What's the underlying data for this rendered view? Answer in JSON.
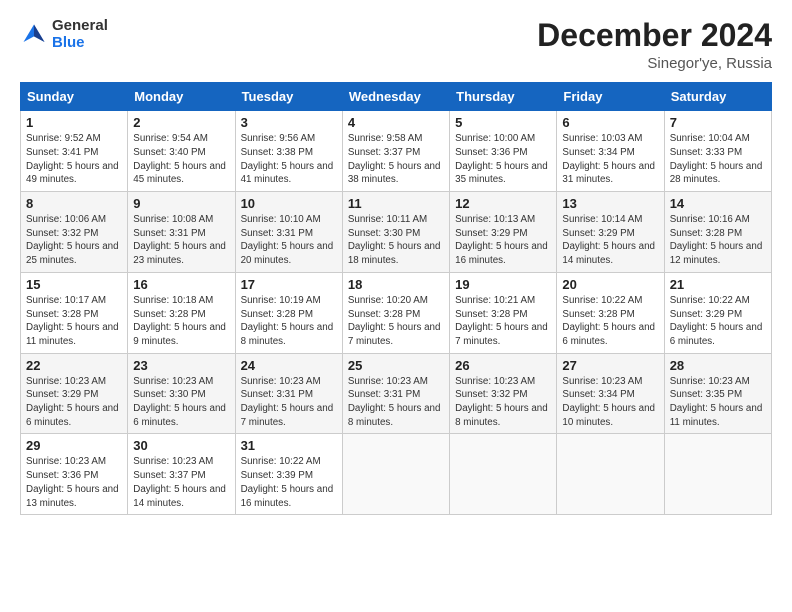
{
  "logo": {
    "text_general": "General",
    "text_blue": "Blue"
  },
  "header": {
    "month": "December 2024",
    "location": "Sinegor'ye, Russia"
  },
  "weekdays": [
    "Sunday",
    "Monday",
    "Tuesday",
    "Wednesday",
    "Thursday",
    "Friday",
    "Saturday"
  ],
  "weeks": [
    [
      {
        "day": "1",
        "sunrise": "9:52 AM",
        "sunset": "3:41 PM",
        "daylight": "5 hours and 49 minutes."
      },
      {
        "day": "2",
        "sunrise": "9:54 AM",
        "sunset": "3:40 PM",
        "daylight": "5 hours and 45 minutes."
      },
      {
        "day": "3",
        "sunrise": "9:56 AM",
        "sunset": "3:38 PM",
        "daylight": "5 hours and 41 minutes."
      },
      {
        "day": "4",
        "sunrise": "9:58 AM",
        "sunset": "3:37 PM",
        "daylight": "5 hours and 38 minutes."
      },
      {
        "day": "5",
        "sunrise": "10:00 AM",
        "sunset": "3:36 PM",
        "daylight": "5 hours and 35 minutes."
      },
      {
        "day": "6",
        "sunrise": "10:03 AM",
        "sunset": "3:34 PM",
        "daylight": "5 hours and 31 minutes."
      },
      {
        "day": "7",
        "sunrise": "10:04 AM",
        "sunset": "3:33 PM",
        "daylight": "5 hours and 28 minutes."
      }
    ],
    [
      {
        "day": "8",
        "sunrise": "10:06 AM",
        "sunset": "3:32 PM",
        "daylight": "5 hours and 25 minutes."
      },
      {
        "day": "9",
        "sunrise": "10:08 AM",
        "sunset": "3:31 PM",
        "daylight": "5 hours and 23 minutes."
      },
      {
        "day": "10",
        "sunrise": "10:10 AM",
        "sunset": "3:31 PM",
        "daylight": "5 hours and 20 minutes."
      },
      {
        "day": "11",
        "sunrise": "10:11 AM",
        "sunset": "3:30 PM",
        "daylight": "5 hours and 18 minutes."
      },
      {
        "day": "12",
        "sunrise": "10:13 AM",
        "sunset": "3:29 PM",
        "daylight": "5 hours and 16 minutes."
      },
      {
        "day": "13",
        "sunrise": "10:14 AM",
        "sunset": "3:29 PM",
        "daylight": "5 hours and 14 minutes."
      },
      {
        "day": "14",
        "sunrise": "10:16 AM",
        "sunset": "3:28 PM",
        "daylight": "5 hours and 12 minutes."
      }
    ],
    [
      {
        "day": "15",
        "sunrise": "10:17 AM",
        "sunset": "3:28 PM",
        "daylight": "5 hours and 11 minutes."
      },
      {
        "day": "16",
        "sunrise": "10:18 AM",
        "sunset": "3:28 PM",
        "daylight": "5 hours and 9 minutes."
      },
      {
        "day": "17",
        "sunrise": "10:19 AM",
        "sunset": "3:28 PM",
        "daylight": "5 hours and 8 minutes."
      },
      {
        "day": "18",
        "sunrise": "10:20 AM",
        "sunset": "3:28 PM",
        "daylight": "5 hours and 7 minutes."
      },
      {
        "day": "19",
        "sunrise": "10:21 AM",
        "sunset": "3:28 PM",
        "daylight": "5 hours and 7 minutes."
      },
      {
        "day": "20",
        "sunrise": "10:22 AM",
        "sunset": "3:28 PM",
        "daylight": "5 hours and 6 minutes."
      },
      {
        "day": "21",
        "sunrise": "10:22 AM",
        "sunset": "3:29 PM",
        "daylight": "5 hours and 6 minutes."
      }
    ],
    [
      {
        "day": "22",
        "sunrise": "10:23 AM",
        "sunset": "3:29 PM",
        "daylight": "5 hours and 6 minutes."
      },
      {
        "day": "23",
        "sunrise": "10:23 AM",
        "sunset": "3:30 PM",
        "daylight": "5 hours and 6 minutes."
      },
      {
        "day": "24",
        "sunrise": "10:23 AM",
        "sunset": "3:31 PM",
        "daylight": "5 hours and 7 minutes."
      },
      {
        "day": "25",
        "sunrise": "10:23 AM",
        "sunset": "3:31 PM",
        "daylight": "5 hours and 8 minutes."
      },
      {
        "day": "26",
        "sunrise": "10:23 AM",
        "sunset": "3:32 PM",
        "daylight": "5 hours and 8 minutes."
      },
      {
        "day": "27",
        "sunrise": "10:23 AM",
        "sunset": "3:34 PM",
        "daylight": "5 hours and 10 minutes."
      },
      {
        "day": "28",
        "sunrise": "10:23 AM",
        "sunset": "3:35 PM",
        "daylight": "5 hours and 11 minutes."
      }
    ],
    [
      {
        "day": "29",
        "sunrise": "10:23 AM",
        "sunset": "3:36 PM",
        "daylight": "5 hours and 13 minutes."
      },
      {
        "day": "30",
        "sunrise": "10:23 AM",
        "sunset": "3:37 PM",
        "daylight": "5 hours and 14 minutes."
      },
      {
        "day": "31",
        "sunrise": "10:22 AM",
        "sunset": "3:39 PM",
        "daylight": "5 hours and 16 minutes."
      },
      null,
      null,
      null,
      null
    ]
  ],
  "labels": {
    "sunrise": "Sunrise:",
    "sunset": "Sunset:",
    "daylight": "Daylight:"
  }
}
